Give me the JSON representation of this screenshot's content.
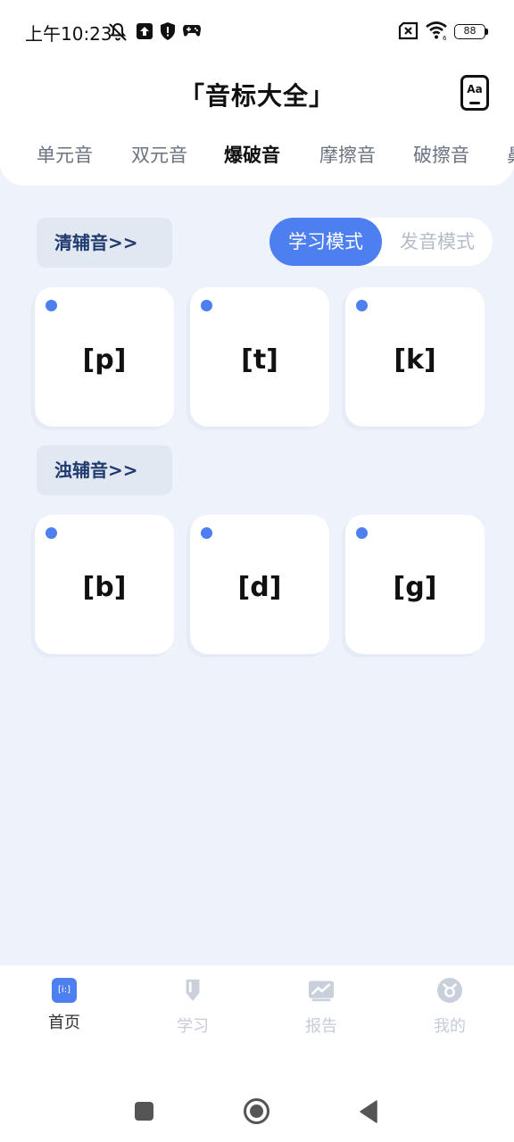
{
  "status_bar": {
    "time": "上午10:23",
    "battery": "88",
    "wifi_sub": "6",
    "icons": [
      "mute-bell-icon",
      "upload-icon",
      "shield-icon",
      "gamepad-icon",
      "sim-off-icon",
      "wifi-icon",
      "battery-icon"
    ]
  },
  "header": {
    "title": "「音标大全」",
    "font_button_label": "Aa"
  },
  "tabs": [
    {
      "label": "单元音",
      "active": false
    },
    {
      "label": "双元音",
      "active": false
    },
    {
      "label": "爆破音",
      "active": true
    },
    {
      "label": "摩擦音",
      "active": false
    },
    {
      "label": "破擦音",
      "active": false
    },
    {
      "label": "鼻",
      "active": false
    }
  ],
  "mode_toggle": {
    "learn": "学习模式",
    "speak": "发音模式",
    "selected": "学习模式"
  },
  "sections": [
    {
      "label": "清辅音>>",
      "cards": [
        "[p]",
        "[t]",
        "[k]"
      ]
    },
    {
      "label": "浊辅音>>",
      "cards": [
        "[b]",
        "[d]",
        "[g]"
      ]
    }
  ],
  "bottom_nav": [
    {
      "label": "首页",
      "icon": "phonetic-home-icon",
      "icon_text": "[i:]",
      "active": true
    },
    {
      "label": "学习",
      "icon": "pencil-icon",
      "active": false
    },
    {
      "label": "报告",
      "icon": "chart-icon",
      "active": false
    },
    {
      "label": "我的",
      "icon": "profile-icon",
      "active": false
    }
  ],
  "colors": {
    "accent": "#4d7ff0",
    "background": "#edf2fb",
    "section_label_bg": "#e2e8f2",
    "section_label_text": "#1f3a6e"
  }
}
